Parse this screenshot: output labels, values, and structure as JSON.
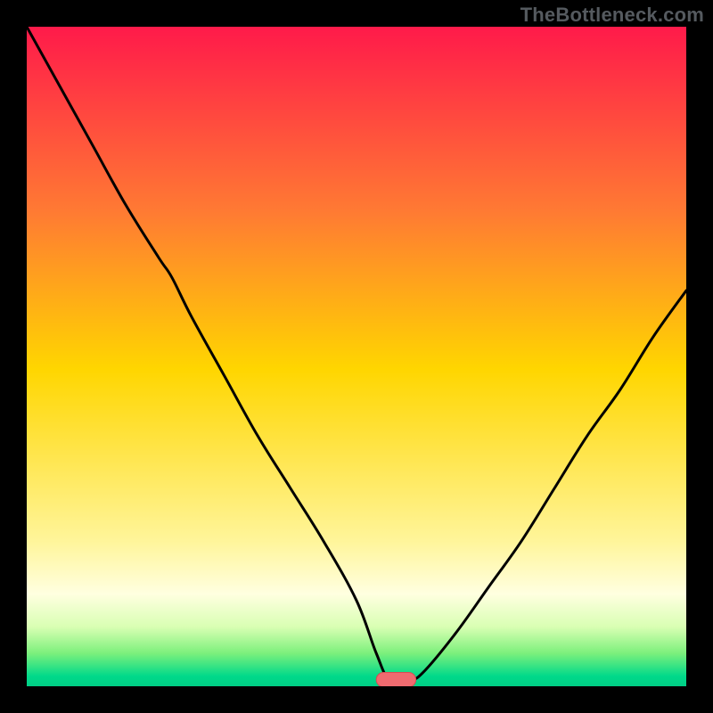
{
  "watermark": "TheBottleneck.com",
  "colors": {
    "frame_bg": "#000000",
    "curve": "#000000",
    "marker_fill": "#ef6a6f",
    "marker_stroke": "#d84b53",
    "gradient_stops": [
      {
        "offset": 0.0,
        "color": "#ff1a4a"
      },
      {
        "offset": 0.28,
        "color": "#ff7a33"
      },
      {
        "offset": 0.52,
        "color": "#ffd600"
      },
      {
        "offset": 0.78,
        "color": "#fff59a"
      },
      {
        "offset": 0.86,
        "color": "#ffffe0"
      },
      {
        "offset": 0.91,
        "color": "#d9ffb3"
      },
      {
        "offset": 0.95,
        "color": "#7cf07c"
      },
      {
        "offset": 0.985,
        "color": "#00d98a"
      },
      {
        "offset": 1.0,
        "color": "#00cf85"
      }
    ]
  },
  "chart_data": {
    "type": "line",
    "title": "",
    "xlabel": "",
    "ylabel": "",
    "xlim": [
      0,
      100
    ],
    "ylim": [
      0,
      100
    ],
    "grid": false,
    "legend": false,
    "marker": {
      "x": 56,
      "y": 1,
      "width": 6,
      "height": 2.2,
      "shape": "rounded-rect"
    },
    "series": [
      {
        "name": "bottleneck-curve",
        "x": [
          0,
          5,
          10,
          15,
          20,
          22,
          25,
          30,
          35,
          40,
          45,
          50,
          53,
          55,
          58,
          60,
          65,
          70,
          75,
          80,
          85,
          90,
          95,
          100
        ],
        "y": [
          100,
          91,
          82,
          73,
          65,
          62,
          56,
          47,
          38,
          30,
          22,
          13,
          5,
          1,
          1,
          2,
          8,
          15,
          22,
          30,
          38,
          45,
          53,
          60
        ]
      }
    ]
  }
}
